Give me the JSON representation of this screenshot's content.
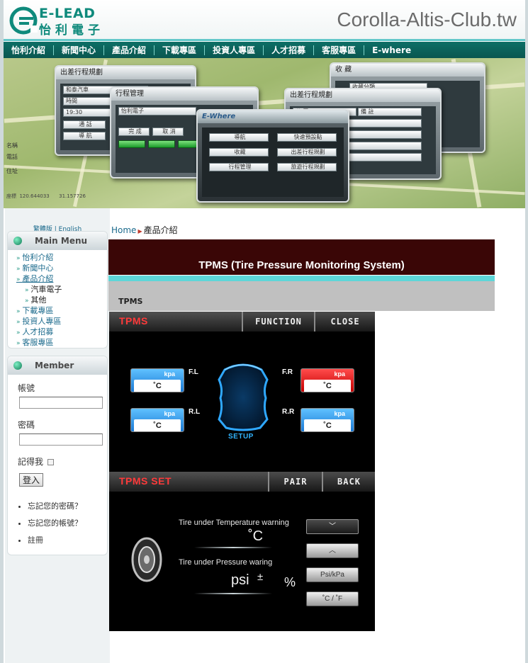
{
  "header": {
    "logo_text": "E-LEAD",
    "logo_chinese": "怡利電子",
    "site_title": "Corolla-Altis-Club.tw"
  },
  "nav": [
    "怡利介紹",
    "新聞中心",
    "產品介紹",
    "下載專區",
    "投資人專區",
    "人才招募",
    "客服專區",
    "E-where"
  ],
  "banner": {
    "win1_title": "出差行程規劃",
    "win1_field1": "和泰汽車",
    "win1_field2": "時間",
    "win1_field3": "19:30",
    "win1_btn1": "通 話",
    "win1_btn2": "導 航",
    "win2_title": "行程管理",
    "win2_field1": "怡利電子",
    "win2_btn1": "完 成",
    "win2_btn2": "取 消",
    "win3_brand": "E-Where",
    "win3_btn1": "導航",
    "win3_btn2": "快速預設點",
    "win3_btn3": "收藏",
    "win3_btn4": "出差行程規劃",
    "win3_btn5": "行程管理",
    "win3_btn6": "旅遊行程規劃",
    "win4_title": "出差行程規劃",
    "win4_col1": "公 司",
    "win4_col2": "備 註",
    "win5_title": "收 藏",
    "win5_field1": "收藏分類",
    "coord1": "120.644033",
    "coord2": "31.157726",
    "label_name": "名稱",
    "label_phone": "電話",
    "label_addr": "住址",
    "label_coord": "座標"
  },
  "sidebar": {
    "lang_zh": "繁體版",
    "lang_sep": "|",
    "lang_en": "English",
    "menu_title": "Main Menu",
    "menu": [
      {
        "label": "怡利介紹",
        "level": 0
      },
      {
        "label": "新聞中心",
        "level": 0
      },
      {
        "label": "產品介紹",
        "level": 0
      },
      {
        "label": "汽車電子",
        "level": 1
      },
      {
        "label": "其他",
        "level": 1
      },
      {
        "label": "下載專區",
        "level": 0
      },
      {
        "label": "投資人專區",
        "level": 0
      },
      {
        "label": "人才招募",
        "level": 0
      },
      {
        "label": "客服專區",
        "level": 0
      }
    ],
    "member_title": "Member",
    "username_label": "帳號",
    "password_label": "密碼",
    "remember_label": "記得我",
    "login_button": "登入",
    "links": [
      "忘記您的密碼？",
      "忘記您的帳號？",
      "註冊"
    ]
  },
  "breadcrumb": {
    "home": "Home",
    "current": "產品介紹"
  },
  "content": {
    "title": "TPMS (Tire Pressure Monitoring System)",
    "subtitle": "TPMS"
  },
  "tpms": {
    "header_title": "TPMS",
    "function_button": "FUNCTION",
    "close_button": "CLOSE",
    "tires": [
      {
        "pos": "F.L",
        "unit_top": "kpa",
        "unit_bot": "˚C",
        "alert": false
      },
      {
        "pos": "F.R",
        "unit_top": "kpa",
        "unit_bot": "˚C",
        "alert": true
      },
      {
        "pos": "R.L",
        "unit_top": "kpa",
        "unit_bot": "˚C",
        "alert": false
      },
      {
        "pos": "R.R",
        "unit_top": "kpa",
        "unit_bot": "˚C",
        "alert": false
      }
    ],
    "setup_label": "SETUP",
    "set_title": "TPMS SET",
    "pair_button": "PAIR",
    "back_button": "BACK",
    "temp_warning_label": "Tire under Temperature warning",
    "temp_unit": "˚C",
    "pressure_warning_label": "Tire under Pressure waring",
    "pressure_unit": "psi",
    "plus_minus": "±",
    "percent": "%",
    "btn_down": "﹀",
    "btn_up": "︿",
    "btn_psi": "Psi/kPa",
    "btn_temp": "˚C / ˚F",
    "colors": {
      "alert": "#e00000",
      "normal": "#1b79d4",
      "header": "#ff3a3a",
      "setup": "#32b4ff"
    }
  }
}
